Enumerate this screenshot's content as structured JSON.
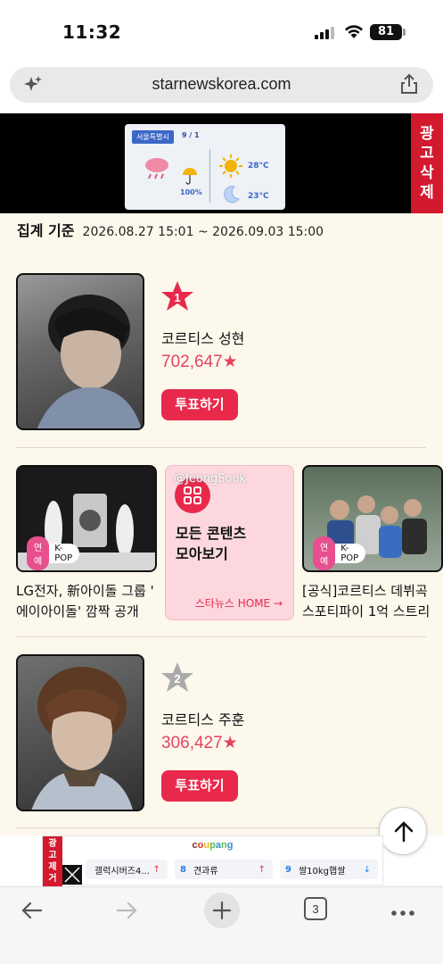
{
  "status_bar": {
    "time": "11:32",
    "battery": "81"
  },
  "browser": {
    "url": "starnewskorea.com",
    "tab_count": "3"
  },
  "top_ad": {
    "region": "서울특별시",
    "date": "9 / 1",
    "rain_chance": "100%",
    "temp_high": "28°C",
    "temp_low": "23°C",
    "delete_label": [
      "광",
      "고",
      "삭",
      "제"
    ]
  },
  "ranking": {
    "period_label": "집계 기준",
    "period_range": "2026.08.27 15:01 ~ 2026.09.03 15:00",
    "items": [
      {
        "rank": "1",
        "name": "코르티스 성현",
        "votes": "702,647★",
        "vote_label": "투표하기"
      },
      {
        "rank": "2",
        "name": "코르티스 주훈",
        "votes": "306,427★",
        "vote_label": "투표하기"
      }
    ]
  },
  "news": {
    "items": [
      {
        "tag1": "연예",
        "tag2": "K-POP",
        "title_line1": "LG전자, 新아이돌 그룹 '",
        "title_line2": "에이아이돌' 깜짝 공개"
      },
      {
        "tag1": "연예",
        "tag2": "K-POP",
        "title_line1": "[공식]코르티스 데뷔곡",
        "title_line2": "스포티파이 1억 스트리"
      }
    ],
    "all_contents": {
      "title_line1": "모든 콘텐츠",
      "title_line2": "모아보기",
      "home_link": "스타뉴스 HOME →"
    },
    "watermark": "@JeongSook"
  },
  "bottom_ad": {
    "brand": "coupang",
    "remove_label": [
      "광",
      "고",
      "제",
      "거"
    ],
    "keywords": [
      {
        "num": "",
        "text": "갤럭시버즈4...",
        "trend": "↑"
      },
      {
        "num": "8",
        "text": "견과류",
        "trend": "↑"
      },
      {
        "num": "9",
        "text": "쌀10kg햅쌀",
        "trend": "↓"
      }
    ]
  },
  "colors": {
    "accent": "#e8294b",
    "votes": "#e2445c",
    "background": "#fdf8ec"
  }
}
